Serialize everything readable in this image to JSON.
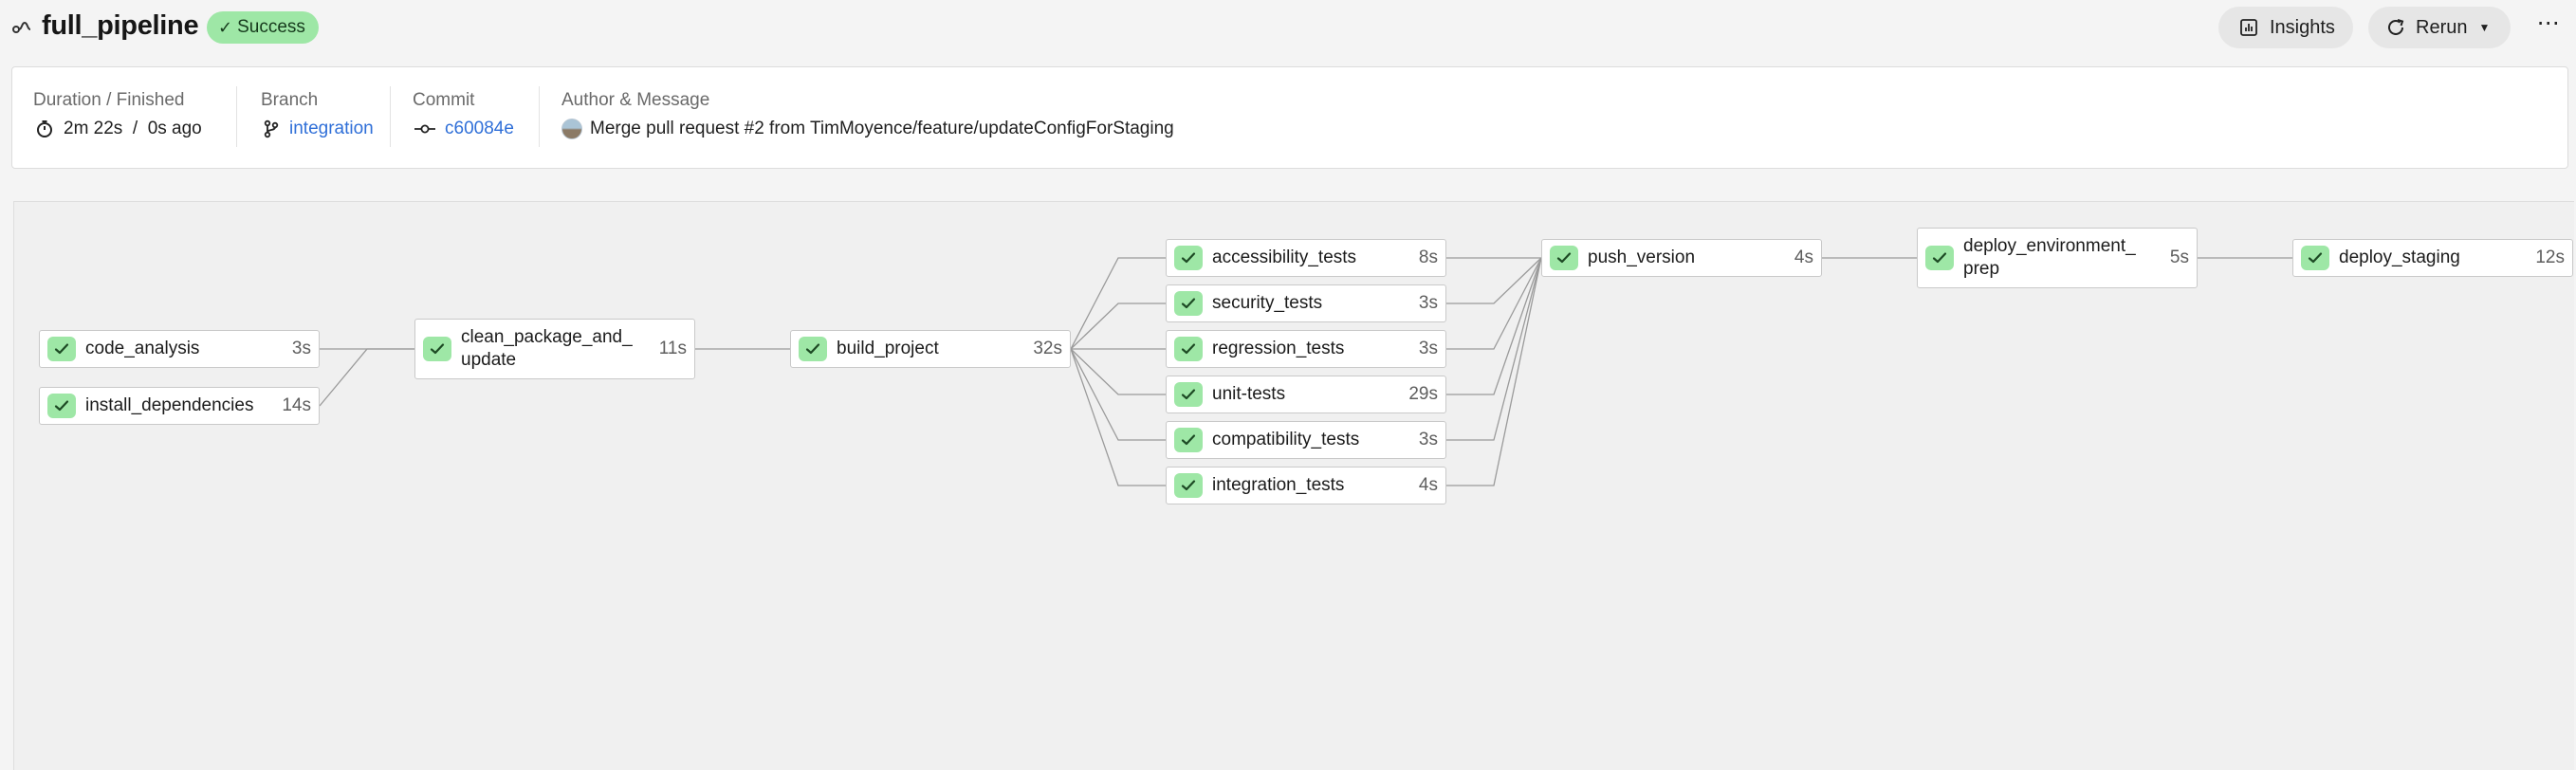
{
  "header": {
    "pipeline_icon": "pipeline-icon",
    "title": "full_pipeline",
    "status": "Success",
    "insights_label": "Insights",
    "rerun_label": "Rerun",
    "more_label": "⋯"
  },
  "info": {
    "duration_label": "Duration / Finished",
    "duration_value": "2m 22s  /  0s ago",
    "branch_label": "Branch",
    "branch_value": "integration",
    "commit_label": "Commit",
    "commit_value": "c60084e",
    "author_label": "Author & Message",
    "author_message": "Merge pull request #2 from TimMoyence/feature/updateConfigForStaging"
  },
  "jobs": [
    {
      "name": "code_analysis",
      "duration": "3s",
      "status": "success"
    },
    {
      "name": "install_dependencies",
      "duration": "14s",
      "status": "success"
    },
    {
      "name": "clean_package_and_\nupdate",
      "duration": "11s",
      "status": "success"
    },
    {
      "name": "build_project",
      "duration": "32s",
      "status": "success"
    },
    {
      "name": "accessibility_tests",
      "duration": "8s",
      "status": "success"
    },
    {
      "name": "security_tests",
      "duration": "3s",
      "status": "success"
    },
    {
      "name": "regression_tests",
      "duration": "3s",
      "status": "success"
    },
    {
      "name": "unit-tests",
      "duration": "29s",
      "status": "success"
    },
    {
      "name": "compatibility_tests",
      "duration": "3s",
      "status": "success"
    },
    {
      "name": "integration_tests",
      "duration": "4s",
      "status": "success"
    },
    {
      "name": "push_version",
      "duration": "4s",
      "status": "success"
    },
    {
      "name": "deploy_environment_\nprep",
      "duration": "5s",
      "status": "success"
    },
    {
      "name": "deploy_staging",
      "duration": "12s",
      "status": "success"
    }
  ],
  "colors": {
    "success_bg": "#9ee7a6",
    "link": "#2f6fd8",
    "edge": "#9a9a9a"
  }
}
